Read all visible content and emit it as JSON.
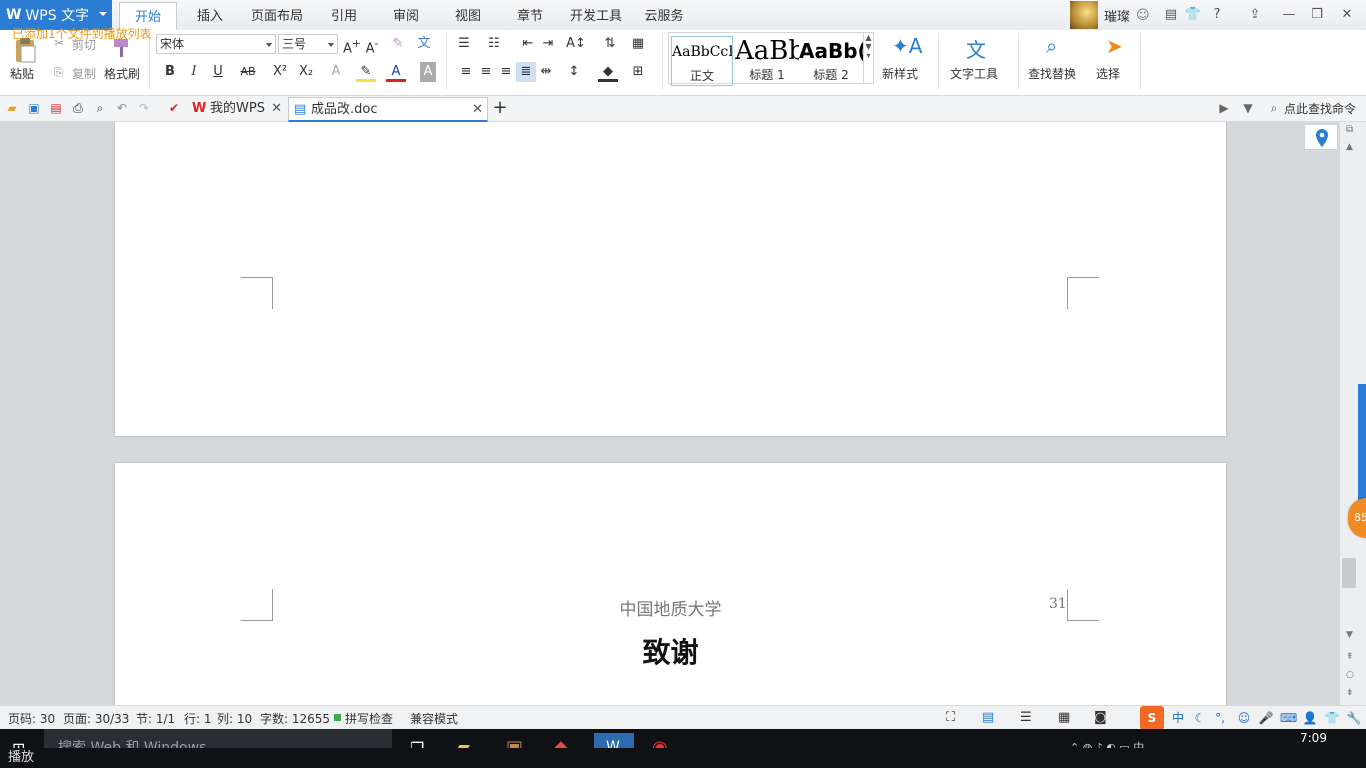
{
  "app": {
    "name": "WPS 文字",
    "notice": "已添加1个文件到播放列表"
  },
  "menu_tabs": [
    "开始",
    "插入",
    "页面布局",
    "引用",
    "审阅",
    "视图",
    "章节",
    "开发工具",
    "云服务"
  ],
  "user": {
    "name": "璀璨"
  },
  "ribbon": {
    "paste": "粘贴",
    "cut": "剪切",
    "copy": "复制",
    "format_painter": "格式刷",
    "font_name": "宋体",
    "font_size": "三号",
    "styles": [
      {
        "sample": "AaBbCcD",
        "name": "正文"
      },
      {
        "sample": "AaBb",
        "name": "标题 1"
      },
      {
        "sample": "AaBb(",
        "name": "标题 2"
      }
    ],
    "new_style": "新样式",
    "text_tools": "文字工具",
    "find_replace": "查找替换",
    "select": "选择"
  },
  "doc_tabs": [
    {
      "label": "我的WPS",
      "active": false
    },
    {
      "label": "成品改.doc",
      "active": true
    }
  ],
  "command_search": "点此查找命令",
  "document": {
    "header_text": "中国地质大学",
    "page_number": "31",
    "heading": "致谢"
  },
  "float_badge": "85",
  "status": {
    "page_code": "页码: 30",
    "page": "页面: 30/33",
    "section": "节: 1/1",
    "row": "行: 1",
    "col": "列: 10",
    "words": "字数: 12655",
    "spell_check": "拼写检查",
    "compat_mode": "兼容模式"
  },
  "taskbar": {
    "search_placeholder": "搜索 Web 和 Windows",
    "time": "7:09",
    "caption": "播放"
  },
  "colors": {
    "accent": "#2b7cd3",
    "notice": "#e89a1b",
    "badge": "#f08a24"
  }
}
